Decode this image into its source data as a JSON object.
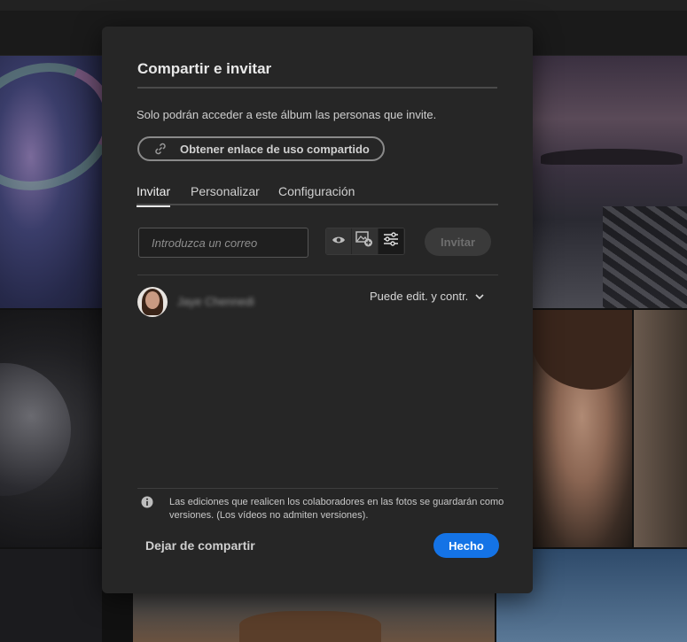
{
  "dialog": {
    "title": "Compartir e invitar",
    "description": "Solo podrán acceder a este álbum las personas que invite.",
    "share_link_label": "Obtener enlace de uso compartido",
    "tabs": [
      {
        "label": "Invitar",
        "active": true
      },
      {
        "label": "Personalizar",
        "active": false
      },
      {
        "label": "Configuración",
        "active": false
      }
    ],
    "email_placeholder": "Introduzca un correo",
    "email_value": "",
    "permission_icons": [
      "eye-icon",
      "add-photo-icon",
      "sliders-icon"
    ],
    "invite_label": "Invitar",
    "invitees": [
      {
        "name": "Jaye Chennedi",
        "role": "Puede edit. y contr."
      }
    ],
    "note": "Las ediciones que realicen los colaboradores en las fotos se guardarán como versiones. (Los vídeos no admiten versiones).",
    "stop_sharing_label": "Dejar de compartir",
    "done_label": "Hecho"
  },
  "colors": {
    "dialog_bg": "#262626",
    "accent": "#1473e6",
    "text": "#d6d6d6"
  }
}
